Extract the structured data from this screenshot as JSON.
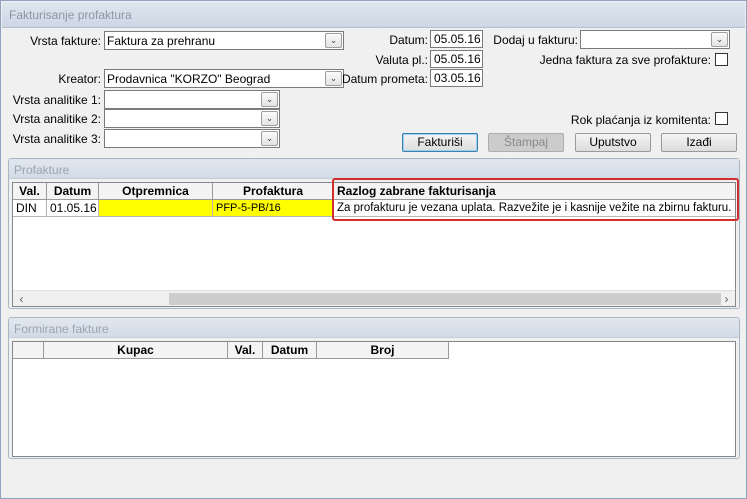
{
  "window": {
    "title": "Fakturisanje profaktura"
  },
  "form": {
    "vrsta_fakture": {
      "label": "Vrsta fakture:",
      "value": "Faktura za prehranu"
    },
    "kreator": {
      "label": "Kreator:",
      "value": "Prodavnica \"KORZO\" Beograd"
    },
    "analitika1": {
      "label": "Vrsta analitike 1:",
      "value": ""
    },
    "analitika2": {
      "label": "Vrsta analitike 2:",
      "value": ""
    },
    "analitika3": {
      "label": "Vrsta analitike 3:",
      "value": ""
    },
    "datum": {
      "label": "Datum:",
      "value": "05.05.16"
    },
    "valuta": {
      "label": "Valuta pl.:",
      "value": "05.05.16"
    },
    "datum_prometa": {
      "label": "Datum prometa:",
      "value": "03.05.16"
    },
    "dodaj": {
      "label": "Dodaj u fakturu:",
      "value": ""
    },
    "jedna_faktura": {
      "label": "Jedna faktura za sve profakture:",
      "checked": false
    },
    "rok_placanja": {
      "label": "Rok plaćanja iz komitenta:",
      "checked": false
    }
  },
  "buttons": {
    "fakturisi": "Fakturiši",
    "stampaj": "Štampaj",
    "uputstvo": "Uputstvo",
    "izadji": "Izađi"
  },
  "profakture": {
    "title": "Profakture",
    "columns": [
      "Val.",
      "Datum",
      "Otpremnica",
      "Profaktura",
      "Razlog zabrane fakturisanja"
    ],
    "rows": [
      [
        "DIN",
        "01.05.16",
        "",
        "PFP-5-PB/16",
        "Za profakturu je vezana uplata. Razvežite je i kasnije vežite na zbirnu fakturu."
      ]
    ]
  },
  "formirane": {
    "title": "Formirane fakture",
    "columns": [
      "Kupac",
      "Val.",
      "Datum",
      "Broj"
    ]
  },
  "colors": {
    "highlight": "#d12f2f",
    "marked_cell": "#ffff00",
    "primary_border": "#3c7fb1"
  }
}
